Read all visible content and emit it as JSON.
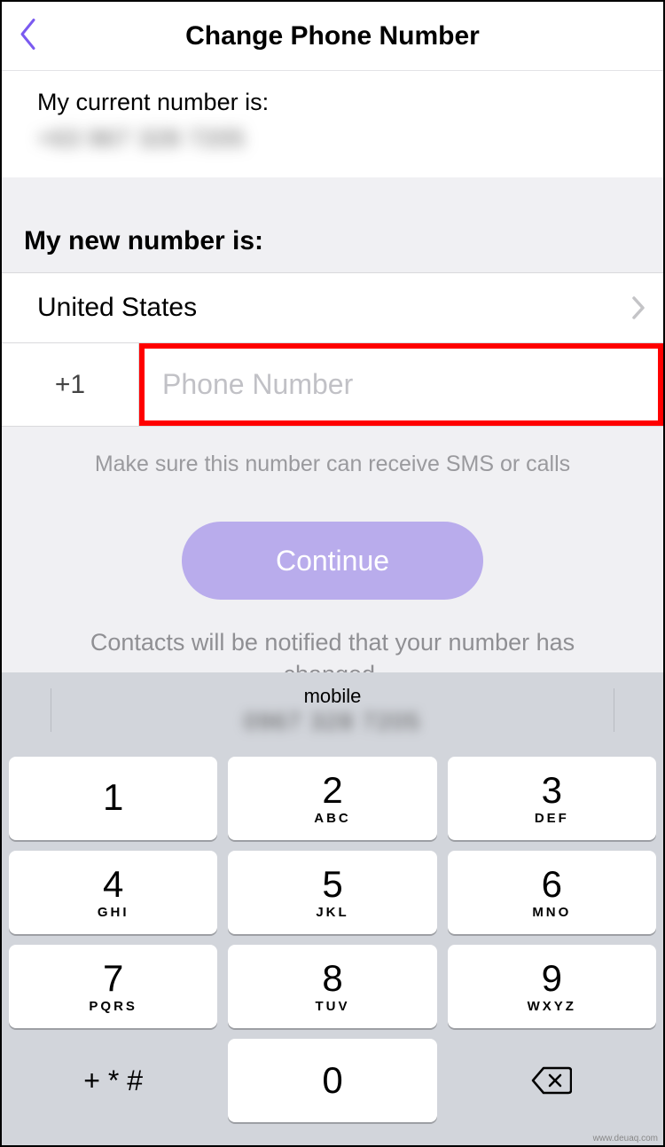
{
  "header": {
    "title": "Change Phone Number"
  },
  "current": {
    "label": "My current number is:",
    "number_masked": "+63 967 328 7205"
  },
  "new_section": {
    "label": "My new number is:",
    "country": "United States",
    "dial_code": "+1",
    "phone_placeholder": "Phone Number",
    "phone_value": ""
  },
  "hint": "Make sure this number can receive SMS or calls",
  "continue_label": "Continue",
  "notify_text": "Contacts will be notified that your number has changed.",
  "keyboard": {
    "suggestion_label": "mobile",
    "suggestion_number": "0967 328 7205",
    "keys": [
      [
        {
          "d": "1",
          "l": ""
        },
        {
          "d": "2",
          "l": "ABC"
        },
        {
          "d": "3",
          "l": "DEF"
        }
      ],
      [
        {
          "d": "4",
          "l": "GHI"
        },
        {
          "d": "5",
          "l": "JKL"
        },
        {
          "d": "6",
          "l": "MNO"
        }
      ],
      [
        {
          "d": "7",
          "l": "PQRS"
        },
        {
          "d": "8",
          "l": "TUV"
        },
        {
          "d": "9",
          "l": "WXYZ"
        }
      ]
    ],
    "symbols": "+ * #",
    "zero": "0"
  },
  "watermark": "www.deuaq.com"
}
